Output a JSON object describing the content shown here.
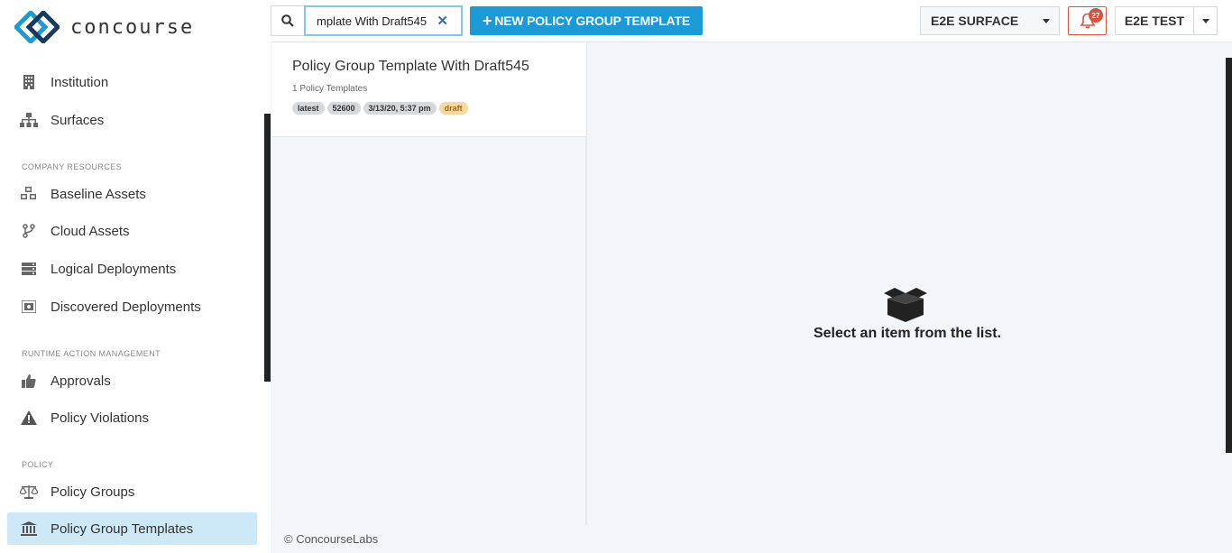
{
  "brand": {
    "name": "concourse"
  },
  "sidebar": {
    "items": [
      {
        "label": "Institution",
        "icon": "building-icon"
      },
      {
        "label": "Surfaces",
        "icon": "sitemap-icon"
      },
      {
        "label": "Baseline Assets",
        "icon": "cubes-icon"
      },
      {
        "label": "Cloud Assets",
        "icon": "branch-icon"
      },
      {
        "label": "Logical Deployments",
        "icon": "server-icon"
      },
      {
        "label": "Discovered Deployments",
        "icon": "scan-icon"
      },
      {
        "label": "Approvals",
        "icon": "thumbs-up-icon"
      },
      {
        "label": "Policy Violations",
        "icon": "warning-icon"
      },
      {
        "label": "Policy Groups",
        "icon": "balance-scale-icon"
      },
      {
        "label": "Policy Group Templates",
        "icon": "institution-icon"
      }
    ],
    "sections": {
      "company_resources": "COMPANY RESOURCES",
      "runtime_action_management": "RUNTIME ACTION MANAGEMENT",
      "policy": "POLICY"
    },
    "active_item": "Policy Group Templates"
  },
  "toolbar": {
    "search_value": "mplate With Draft545",
    "new_button_label": "NEW POLICY GROUP TEMPLATE",
    "surface_label": "E2E SURFACE",
    "notification_count": "27",
    "user_label": "E2E TEST"
  },
  "list": {
    "items": [
      {
        "title": "Policy Group Template With Draft545",
        "subtitle": "1 Policy Templates",
        "tags": [
          "latest",
          "52600",
          "3/13/20, 5:37 pm",
          "draft"
        ]
      }
    ]
  },
  "detail": {
    "empty_message": "Select an item from the list."
  },
  "footer": {
    "copyright": "© ConcourseLabs"
  },
  "colors": {
    "accent": "#1a9ad6",
    "active_nav": "#cde8f6",
    "alert": "#d9533c",
    "draft_tag": "#fad7a0"
  }
}
